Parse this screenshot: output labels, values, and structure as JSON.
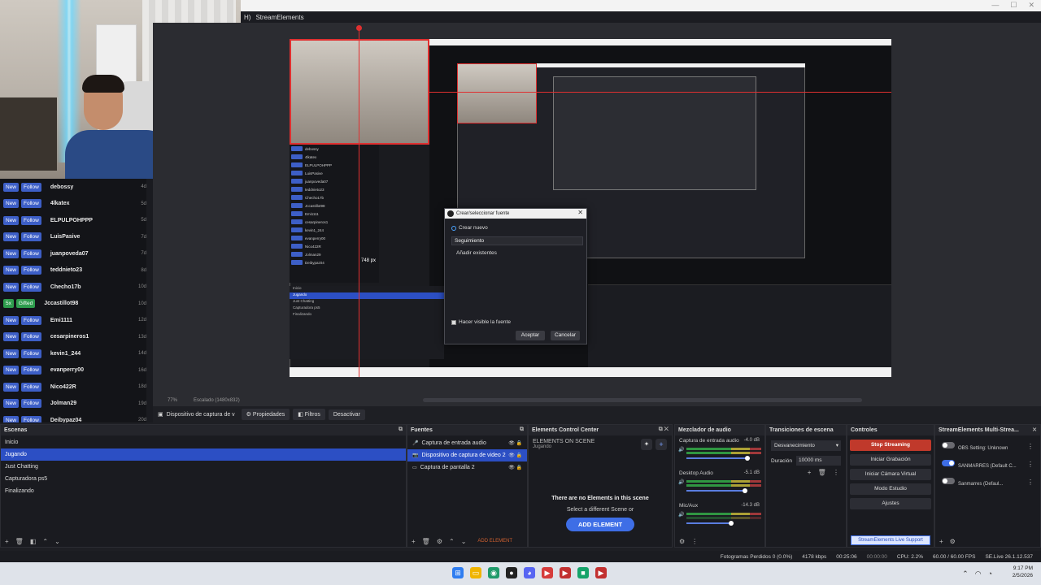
{
  "window": {
    "title": "StreamElements",
    "title_prefix": "H)",
    "controls": [
      "—",
      "☐",
      "✕"
    ]
  },
  "chat": [
    {
      "badge": "New",
      "label": "Follow",
      "name": "debossy",
      "time": "4d"
    },
    {
      "badge": "New",
      "label": "Follow",
      "name": "4lkatex",
      "time": "5d"
    },
    {
      "badge": "New",
      "label": "Follow",
      "name": "ELPULPOHPPP",
      "time": "5d"
    },
    {
      "badge": "New",
      "label": "Follow",
      "name": "LuisPasive",
      "time": "7d"
    },
    {
      "badge": "New",
      "label": "Follow",
      "name": "juanpoveda07",
      "time": "7d"
    },
    {
      "badge": "New",
      "label": "Follow",
      "name": "teddnieto23",
      "time": "8d"
    },
    {
      "badge": "New",
      "label": "Follow",
      "name": "Checho17b",
      "time": "10d"
    },
    {
      "badge": "5x",
      "label": "Gifted",
      "name": "Jccastillot98",
      "time": "10d",
      "gift": true
    },
    {
      "badge": "New",
      "label": "Follow",
      "name": "Emi1111",
      "time": "12d"
    },
    {
      "badge": "New",
      "label": "Follow",
      "name": "cesarpineros1",
      "time": "13d"
    },
    {
      "badge": "New",
      "label": "Follow",
      "name": "kevin1_244",
      "time": "14d"
    },
    {
      "badge": "New",
      "label": "Follow",
      "name": "evanperry00",
      "time": "16d"
    },
    {
      "badge": "New",
      "label": "Follow",
      "name": "Nico422R",
      "time": "18d"
    },
    {
      "badge": "New",
      "label": "Follow",
      "name": "Jolman29",
      "time": "19d"
    },
    {
      "badge": "New",
      "label": "Follow",
      "name": "Deibypaz04",
      "time": "20d"
    }
  ],
  "preview": {
    "size_readout": "748 px",
    "mini_chat": [
      "debossy",
      "4lkatex",
      "ELPULPOHPPP",
      "LuisPasive",
      "juanpoveda07",
      "teddnieto23",
      "Checho17b",
      "Jccastillot98",
      "Emi1111",
      "cesarpineros1",
      "kevin1_244",
      "evanperry00",
      "Nico422R",
      "Jolman29",
      "Deibypaz04"
    ],
    "mini_scenes": [
      "Inicio",
      "Jugando",
      "Just Chatting",
      "Capturadora ps5",
      "Finalizando"
    ],
    "zoom_label": "77%",
    "scale_label": "Escalado (1480x832)"
  },
  "dialog": {
    "title": "Crear/seleccionar fuente",
    "create_new": "Crear nuevo",
    "name_value": "Seguimiento",
    "add_existing": "Añadir existentes",
    "visible_label": "Hacer visible la fuente",
    "accept": "Aceptar",
    "cancel": "Cancelar"
  },
  "source_toolbar": {
    "source_name": "Dispositivo de captura de v",
    "properties": "Propiedades",
    "filters": "Filtros",
    "deactivate": "Desactivar"
  },
  "scenes": {
    "title": "Escenas",
    "items": [
      "Inicio",
      "Jugando",
      "Just Chatting",
      "Capturadora ps5",
      "Finalizando"
    ],
    "selected_index": 1
  },
  "sources": {
    "title": "Fuentes",
    "items": [
      {
        "name": "Captura de entrada audio"
      },
      {
        "name": "Dispositivo de captura de video 2"
      },
      {
        "name": "Captura de pantalla 2"
      }
    ],
    "selected_index": 1,
    "add_element": "ADD ELEMENT"
  },
  "elements": {
    "title": "Elements Control Center",
    "on_scene": "ELEMENTS ON SCENE",
    "scene": "Jugando",
    "empty": "There are no Elements in this scene",
    "hint": "Select a different Scene or",
    "add_button": "ADD ELEMENT"
  },
  "mixer": {
    "title": "Mezclador de audio",
    "channels": [
      {
        "name": "Captura de entrada audio",
        "db": "-4.0 dB",
        "level": 0.82
      },
      {
        "name": "Desktop Audio",
        "db": "-5.1 dB",
        "level": 0.78
      },
      {
        "name": "Mic/Aux",
        "db": "-14.3 dB",
        "level": 0.6
      }
    ]
  },
  "transitions": {
    "title": "Transiciones de escena",
    "selected": "Desvanecimiento",
    "duration_label": "Duración",
    "duration": "10000 ms"
  },
  "controls": {
    "title": "Controles",
    "stop_streaming": "Stop Streaming",
    "start_recording": "Iniciar Grabación",
    "virtual_camera": "Iniciar Cámara Virtual",
    "studio_mode": "Modo Estudio",
    "settings": "Ajustes",
    "se_support": "StreamElements Live Support"
  },
  "multistream": {
    "title": "StreamElements Multi-Strea...",
    "rows": [
      {
        "line1": "OBS Setting: Unknown",
        "on": false
      },
      {
        "line1": "SANMARRES (Default C...",
        "on": true
      },
      {
        "line1": "Sanmarres (Defaul...",
        "on": false
      }
    ]
  },
  "status": {
    "dropped": "Fotogramas Perdidos 0 (0.0%)",
    "bitrate": "4178 kbps",
    "live_time": "00:25:06",
    "rec_time": "00:00:00",
    "cpu": "CPU: 2.2%",
    "fps": "60.00 / 60.00 FPS",
    "version": "SE.Live 26.1.12.537"
  },
  "taskbar": {
    "time": "9:17 PM",
    "date": "2/5/2026"
  },
  "colors": {
    "accent": "#2c4fc4",
    "live_red": "#c0392b",
    "selection_red": "#e03030",
    "follow_badge": "#3d5fc7",
    "gift_badge": "#2e9d4d"
  }
}
